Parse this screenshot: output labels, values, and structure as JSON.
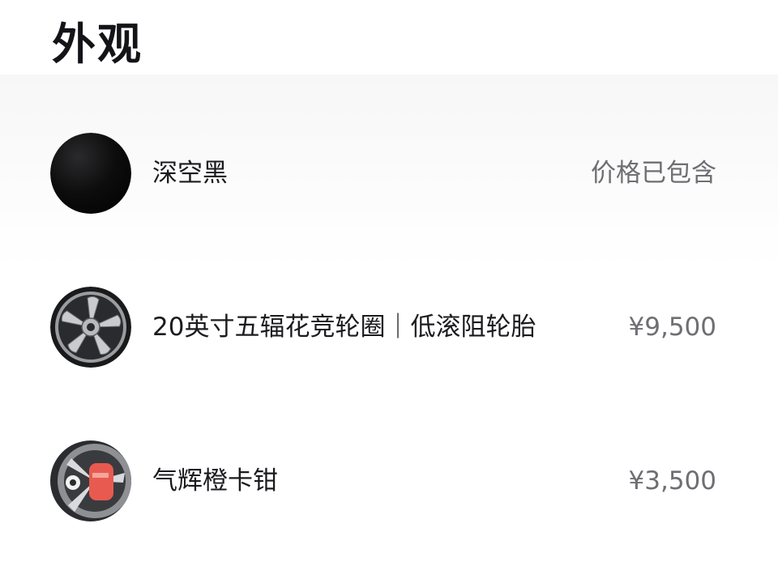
{
  "section": {
    "title": "外观"
  },
  "options": [
    {
      "name": "深空黑",
      "price": "价格已包含",
      "icon": "black-paint-swatch-icon",
      "color": "#0b0b0c"
    },
    {
      "name": "20英寸五辐花竞轮圈｜低滚阻轮胎",
      "price": "¥9,500",
      "icon": "five-spoke-wheel-icon"
    },
    {
      "name": "气辉橙卡钳",
      "price": "¥3,500",
      "icon": "orange-brake-caliper-icon",
      "color": "#e85a4f"
    }
  ]
}
